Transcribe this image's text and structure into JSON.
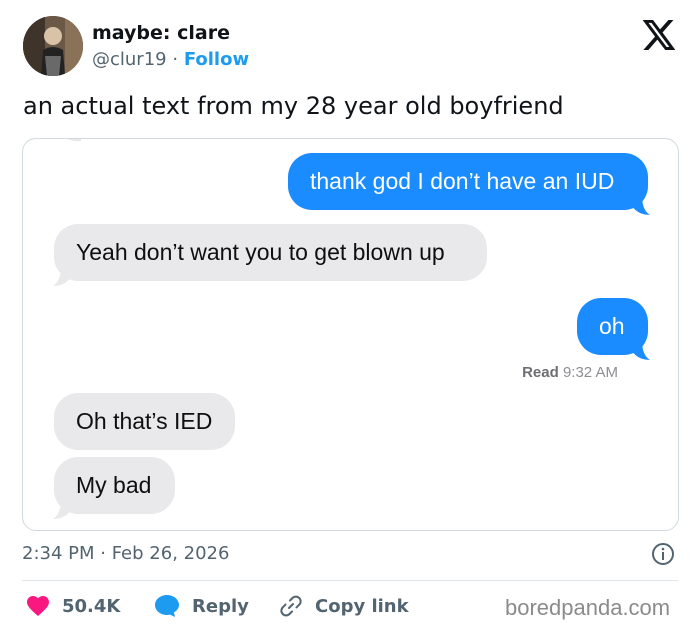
{
  "author": {
    "display_name": "maybe: clare",
    "handle": "@clur19",
    "separator": "·",
    "follow_label": "Follow"
  },
  "tweet": {
    "text": "an actual text from my 28 year old boyfriend",
    "timestamp": "2:34 PM · Feb 26, 2026"
  },
  "conversation": {
    "messages": [
      {
        "sender": "me",
        "text": "thank god I don’t have an IUD"
      },
      {
        "sender": "them",
        "text": "Yeah don’t want you to get blown up"
      },
      {
        "sender": "me",
        "text": "oh"
      },
      {
        "sender": "them",
        "text": "Oh that’s IED"
      },
      {
        "sender": "them",
        "text": "My bad"
      }
    ],
    "read_label": "Read",
    "read_time": "9:32 AM",
    "colors": {
      "outgoing": "#1a8cff",
      "incoming": "#e9e9eb"
    }
  },
  "actions": {
    "likes": "50.4K",
    "reply_label": "Reply",
    "copy_link_label": "Copy link"
  },
  "watermark": "boredpanda.com",
  "icons": [
    "x-logo-icon",
    "info-icon",
    "heart-icon",
    "reply-bubble-icon",
    "link-icon"
  ],
  "colors": {
    "accent": "#1d9bf0",
    "like": "#f91880",
    "text": "#0f1419",
    "muted": "#536471"
  }
}
